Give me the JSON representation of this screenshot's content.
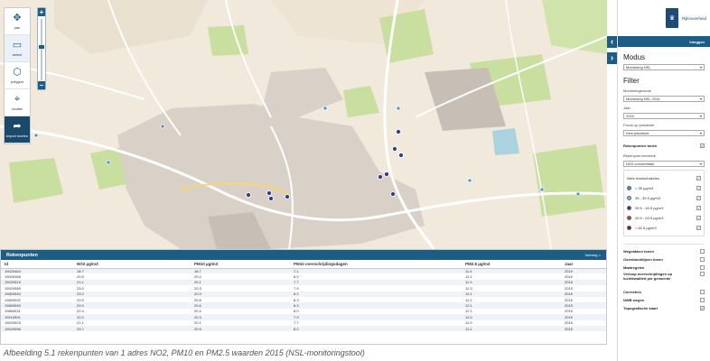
{
  "toolbar": {
    "tools": [
      {
        "icon": "pan-icon",
        "glyph": "✥",
        "label": "pan"
      },
      {
        "icon": "select-icon",
        "glyph": "▭",
        "label": "select"
      },
      {
        "icon": "polygon-icon",
        "glyph": "⬡",
        "label": "polygon"
      },
      {
        "icon": "locate-icon",
        "glyph": "⌖",
        "label": "locatie"
      },
      {
        "icon": "export-icon",
        "glyph": "➦",
        "label": "export doelen"
      }
    ]
  },
  "zoom": {
    "plus": "+",
    "minus": "−",
    "level": 0.55
  },
  "panel": {
    "brand": "Rijksoverheid",
    "login": "Inloggen",
    "modus_title": "Modus",
    "modus_value": "Monitoring NSL",
    "filter_title": "Filter",
    "monitoringsronde_label": "Monitoringsronde",
    "monitoringsronde_value": "Monitoring NSL 2016",
    "jaar_label": "Jaar",
    "jaar_value": "2015",
    "focus_label": "Focus op jurisdictie",
    "focus_value": "Kies jurisdictie",
    "rekenpunten_tonen": "Rekenpunten tonen",
    "rekenpunt_kenmerk_label": "Rekenpunt kenmerk",
    "rekenpunt_kenmerk_value": "NO2-concentratie",
    "legend_all": "Alles in/uitschakelen",
    "legend": [
      {
        "label": "< 35 µg/m3",
        "color": "#4a8fc7"
      },
      {
        "label": "35 - 39.5 µg/m3",
        "color": "#7fb3d9"
      },
      {
        "label": "39.5 - 40.5 µg/m3",
        "color": "#2a3d8f"
      },
      {
        "label": "40.5 - 62.5 µg/m3",
        "color": "#c0392b"
      },
      {
        "label": "> 62.5 µg/m3",
        "color": "#7a1a1a"
      }
    ],
    "layers": [
      {
        "label": "Wegvakken tonen",
        "checked": false
      },
      {
        "label": "Overdrachtlijnen tonen",
        "checked": false
      },
      {
        "label": "Maatregelen",
        "checked": false
      },
      {
        "label": "Verloop overschrijdingen op luchtkwaliteit per gemeente",
        "checked": false
      },
      {
        "label": "Correcties",
        "checked": false
      },
      {
        "label": "NWB wegen",
        "checked": false
      },
      {
        "label": "Topografische kaart",
        "checked": true
      }
    ]
  },
  "table": {
    "title": "Rekenpunten",
    "action": "Verberg",
    "columns": [
      "Id",
      "NO2 µg/m3",
      "PM10 µg/m3",
      "PM10 overschrijdingsdagen",
      "PM2.5 µg/m3",
      "Jaar"
    ],
    "rows": [
      [
        "19020464",
        "18.7",
        "18.7",
        "7.1",
        "11.4",
        "2015"
      ],
      [
        "19020468",
        "20.9",
        "20.4",
        "8.0",
        "12.1",
        "2015"
      ],
      [
        "19020519",
        "21.1",
        "20.1",
        "7.7",
        "11.9",
        "2015"
      ],
      [
        "19020589",
        "23.0",
        "20.3",
        "7.9",
        "12.3",
        "2015"
      ],
      [
        "19800540",
        "23.2",
        "20.3",
        "8.2",
        "12.1",
        "2015"
      ],
      [
        "19800592",
        "23.9",
        "20.6",
        "8.3",
        "12.1",
        "2015"
      ],
      [
        "19800545",
        "23.9",
        "20.6",
        "8.3",
        "12.1",
        "2015"
      ],
      [
        "19860531",
        "22.4",
        "20.4",
        "8.0",
        "12.1",
        "2015"
      ],
      [
        "19010591",
        "22.0",
        "20.3",
        "7.9",
        "12.0",
        "2015"
      ],
      [
        "19020523",
        "21.1",
        "20.1",
        "7.7",
        "11.9",
        "2015"
      ],
      [
        "19020596",
        "23.7",
        "20.5",
        "8.2",
        "12.1",
        "2015"
      ]
    ]
  },
  "caption": "Afbeelding 5.1 rekenpunten van 1 adres NO2, PM10 en PM2.5 waarden 2015 (NSL-monitoringstool)",
  "colors": {
    "accent": "#1c5d86",
    "map_bg": "#f1e9dc",
    "road": "#ffffff",
    "block": "#d9d0c7",
    "green": "#c8df9f"
  }
}
